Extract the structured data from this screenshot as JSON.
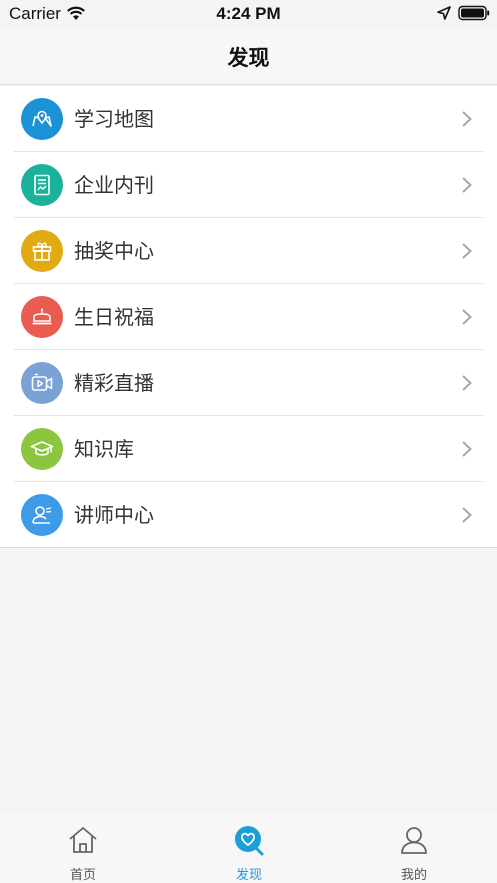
{
  "status_bar": {
    "carrier": "Carrier",
    "time": "4:24 PM"
  },
  "header": {
    "title": "发现"
  },
  "menu": {
    "items": [
      {
        "label": "学习地图",
        "icon": "map-pin-icon",
        "color": "#1b91d6"
      },
      {
        "label": "企业内刊",
        "icon": "journal-icon",
        "color": "#1bb19a"
      },
      {
        "label": "抽奖中心",
        "icon": "gift-icon",
        "color": "#e2aa12"
      },
      {
        "label": "生日祝福",
        "icon": "cake-icon",
        "color": "#ea5b50"
      },
      {
        "label": "精彩直播",
        "icon": "video-icon",
        "color": "#7ba2d6"
      },
      {
        "label": "知识库",
        "icon": "graduation-cap-icon",
        "color": "#8cc63f"
      },
      {
        "label": "讲师中心",
        "icon": "teacher-icon",
        "color": "#3d9be9"
      }
    ]
  },
  "tab_bar": {
    "tabs": [
      {
        "label": "首页",
        "icon": "home-icon",
        "active": false
      },
      {
        "label": "发现",
        "icon": "discover-icon",
        "active": true
      },
      {
        "label": "我的",
        "icon": "profile-icon",
        "active": false
      }
    ],
    "active_color": "#1c9fd8",
    "inactive_color": "#555555"
  }
}
